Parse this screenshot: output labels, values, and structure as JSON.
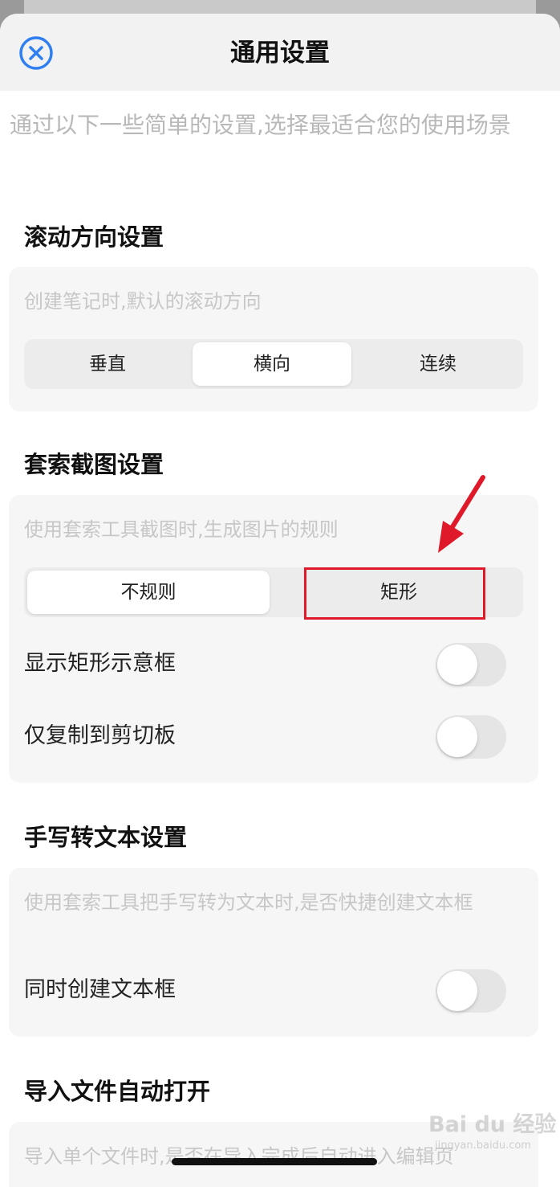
{
  "header": {
    "title": "通用设置"
  },
  "intro": "通过以下一些简单的设置,选择最适合您的使用场景",
  "scroll_direction": {
    "title": "滚动方向设置",
    "desc": "创建笔记时,默认的滚动方向",
    "options": [
      "垂直",
      "横向",
      "连续"
    ],
    "selected": "横向"
  },
  "lasso": {
    "title": "套索截图设置",
    "desc": "使用套索工具截图时,生成图片的规则",
    "options": [
      "不规则",
      "矩形"
    ],
    "selected": "不规则",
    "show_rect_label": "显示矩形示意框",
    "show_rect_on": false,
    "clipboard_label": "仅复制到剪切板",
    "clipboard_on": false
  },
  "handwriting": {
    "title": "手写转文本设置",
    "desc": "使用套索工具把手写转为文本时,是否快捷创建文本框",
    "create_textbox_label": "同时创建文本框",
    "create_textbox_on": false
  },
  "import": {
    "title": "导入文件自动打开",
    "desc": "导入单个文件时,是否在导入完成后自动进入编辑页"
  },
  "annotation": {
    "highlight_color": "#e0192a"
  },
  "watermark": {
    "text": "Bai du 经验",
    "sub": "jingyan.baidu.com"
  },
  "colors": {
    "accent": "#2f7ff0",
    "card_bg": "#f6f6f6",
    "header_bg": "#f2f2f2"
  }
}
